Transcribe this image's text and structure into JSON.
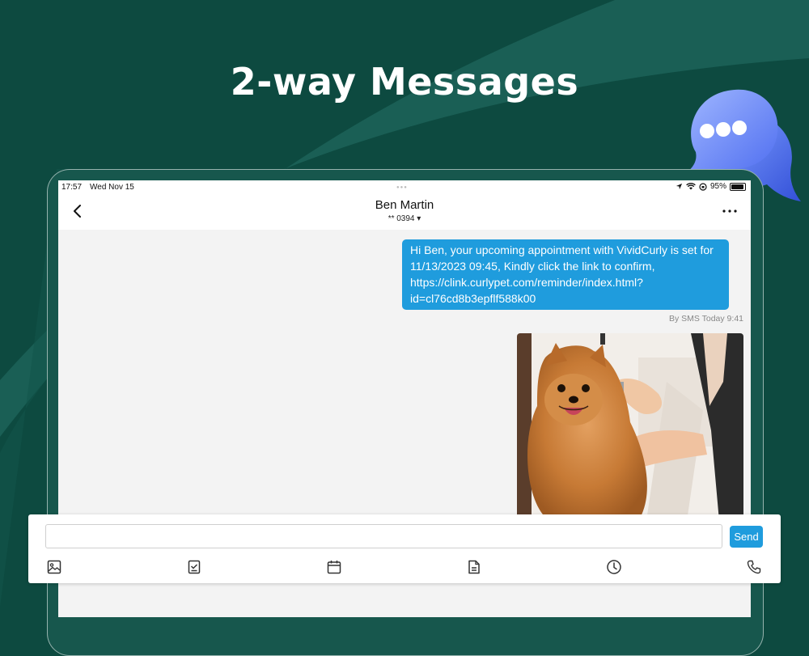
{
  "promo": {
    "headline": "2-way Messages"
  },
  "status_bar": {
    "time": "17:57",
    "date": "Wed Nov 15",
    "battery_percent": "95%",
    "battery_level": 0.95,
    "icons": [
      "location-icon",
      "wifi-icon",
      "orientation-lock-icon",
      "battery-icon"
    ]
  },
  "header": {
    "contact_name": "Ben Martin",
    "contact_number": "** 0394 ▾",
    "back_icon": "chevron-left-icon",
    "more_icon": "more-dots-icon"
  },
  "messages": [
    {
      "type": "text",
      "text": "Hi Ben, your upcoming appointment with VividCurly is set for 11/13/2023 09:45, Kindly click the link to confirm, https://clink.curlypet.com/reminder/index.html?id=cl76cd8b3epflf588k00",
      "meta": "By SMS Today 9:41"
    },
    {
      "type": "image",
      "subject": "pomeranian-being-groomed"
    }
  ],
  "composer": {
    "input_value": "",
    "input_placeholder": "",
    "send_label": "Send",
    "tools": [
      "image-icon",
      "checklist-icon",
      "calendar-icon",
      "document-icon",
      "clock-icon",
      "phone-icon"
    ]
  },
  "colors": {
    "background": "#0d4a40",
    "accent": "#1f9cdd",
    "bubble_text": "#ffffff"
  }
}
